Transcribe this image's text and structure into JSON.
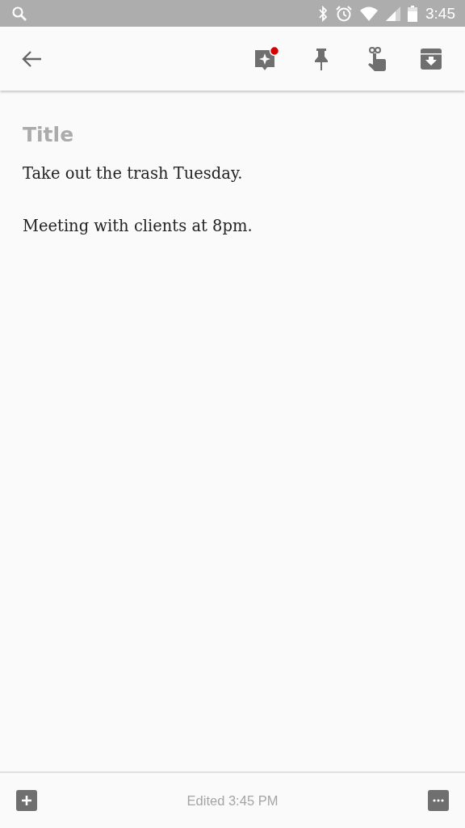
{
  "status_bar": {
    "time": "3:45"
  },
  "note": {
    "title_placeholder": "Title",
    "lines": [
      "Take out the trash Tuesday.",
      "Meeting with clients at 8pm."
    ]
  },
  "footer": {
    "edited": "Edited 3:45 PM"
  }
}
